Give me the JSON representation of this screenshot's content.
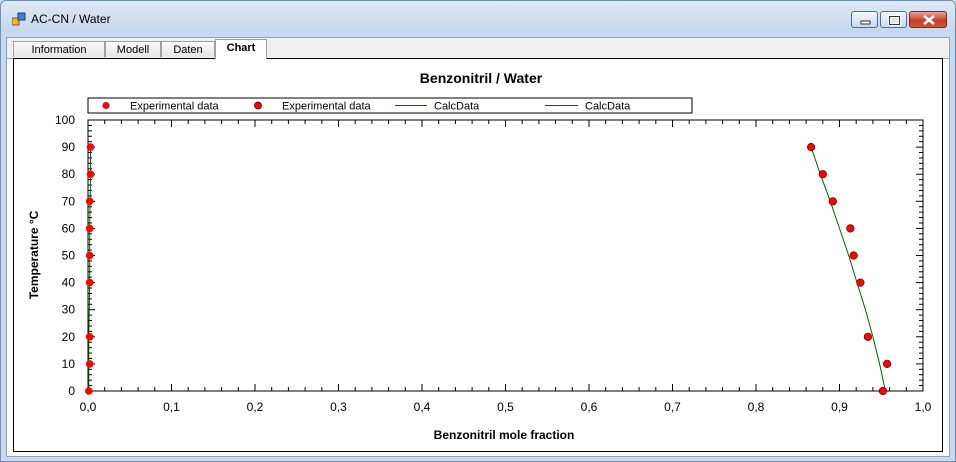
{
  "window": {
    "title": "AC-CN / Water"
  },
  "tabs": [
    {
      "label": "Information"
    },
    {
      "label": "Modell"
    },
    {
      "label": "Daten"
    },
    {
      "label": "Chart"
    }
  ],
  "colors": {
    "marker": "#ff0000",
    "calc_line": "#006400"
  },
  "chart_data": {
    "type": "scatter",
    "title": "Benzonitril / Water",
    "xlabel": "Benzonitril mole fraction",
    "ylabel": "Temperature °C",
    "xlim": [
      0,
      1
    ],
    "ylim": [
      0,
      100
    ],
    "x_ticks": [
      "0,0",
      "0,1",
      "0,2",
      "0,3",
      "0,4",
      "0,5",
      "0,6",
      "0,7",
      "0,8",
      "0,9",
      "1,0"
    ],
    "y_ticks": [
      "0",
      "10",
      "20",
      "30",
      "40",
      "50",
      "60",
      "70",
      "80",
      "90",
      "100"
    ],
    "grid": false,
    "legend_position": "top",
    "series": [
      {
        "name": "Experimental data",
        "kind": "markers",
        "points": [
          [
            0.001,
            0
          ],
          [
            0.002,
            10
          ],
          [
            0.002,
            20
          ],
          [
            0.002,
            40
          ],
          [
            0.002,
            50
          ],
          [
            0.002,
            60
          ],
          [
            0.002,
            70
          ],
          [
            0.003,
            80
          ],
          [
            0.003,
            90
          ]
        ]
      },
      {
        "name": "Experimental data",
        "kind": "markers",
        "points": [
          [
            0.952,
            0
          ],
          [
            0.957,
            10
          ],
          [
            0.934,
            20
          ],
          [
            0.925,
            40
          ],
          [
            0.917,
            50
          ],
          [
            0.913,
            60
          ],
          [
            0.892,
            70
          ],
          [
            0.88,
            80
          ],
          [
            0.866,
            90
          ]
        ]
      },
      {
        "name": "CalcData",
        "kind": "line",
        "points": [
          [
            0.001,
            0
          ],
          [
            0.001,
            20
          ],
          [
            0.002,
            40
          ],
          [
            0.002,
            60
          ],
          [
            0.003,
            80
          ],
          [
            0.003,
            90
          ]
        ]
      },
      {
        "name": "CalcData",
        "kind": "line",
        "points": [
          [
            0.955,
            0
          ],
          [
            0.948,
            10
          ],
          [
            0.94,
            20
          ],
          [
            0.931,
            30
          ],
          [
            0.921,
            40
          ],
          [
            0.911,
            50
          ],
          [
            0.9,
            60
          ],
          [
            0.889,
            70
          ],
          [
            0.877,
            80
          ],
          [
            0.866,
            90
          ]
        ]
      }
    ]
  }
}
